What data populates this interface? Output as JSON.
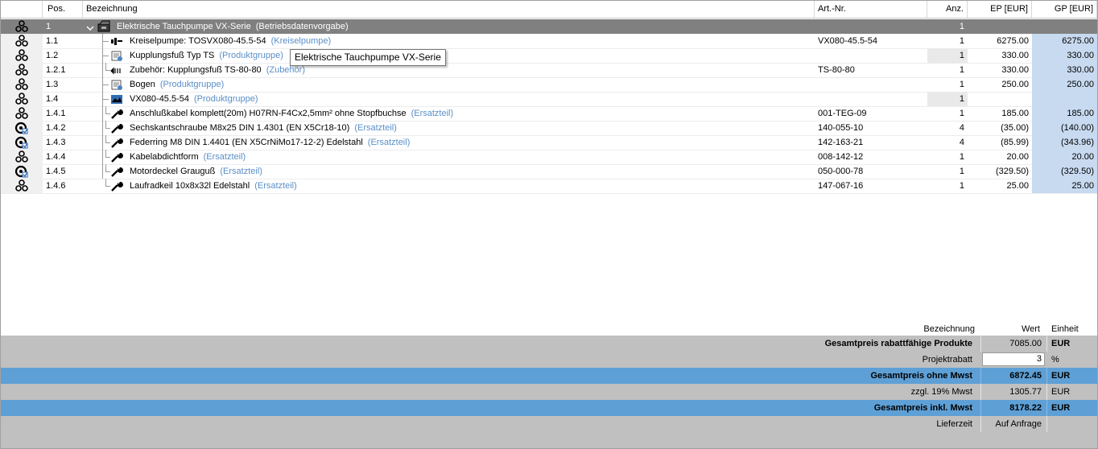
{
  "header": {
    "pos": "Pos.",
    "bezeichnung": "Bezeichnung",
    "artnr": "Art.-Nr.",
    "anz": "Anz.",
    "ep": "EP [EUR]",
    "gp": "GP [EUR]"
  },
  "rows": [
    {
      "pos": "1",
      "name": "Elektrische Tauchpumpe VX-Serie",
      "group": "(Betriebsdatenvorgabe)",
      "art": "",
      "anz": "1",
      "ep": "",
      "gp": "",
      "icon": "pump-set-icon",
      "status": "chain-icon"
    },
    {
      "pos": "1.1",
      "name": "Kreiselpumpe: TOSVX080-45.5-54",
      "group": "(Kreiselpumpe)",
      "art": "VX080-45.5-54",
      "anz": "1",
      "ep": "6275.00",
      "gp": "6275.00",
      "icon": "centrifugal-pump-icon",
      "status": "chain-icon"
    },
    {
      "pos": "1.2",
      "name": "Kupplungsfuß Typ TS",
      "group": "(Produktgruppe)",
      "art": "",
      "anz": "1",
      "ep": "330.00",
      "gp": "330.00",
      "icon": "product-group-icon",
      "status": "chain-icon"
    },
    {
      "pos": "1.2.1",
      "name": "Zubehör: Kupplungsfuß TS-80-80",
      "group": "(Zubehör)",
      "art": "TS-80-80",
      "anz": "1",
      "ep": "330.00",
      "gp": "330.00",
      "icon": "accessory-icon",
      "status": "chain-icon"
    },
    {
      "pos": "1.3",
      "name": "Bogen",
      "group": "(Produktgruppe)",
      "art": "",
      "anz": "1",
      "ep": "250.00",
      "gp": "250.00",
      "icon": "product-group-icon",
      "status": "chain-icon"
    },
    {
      "pos": "1.4",
      "name": "VX080-45.5-54",
      "group": "(Produktgruppe)",
      "art": "",
      "anz": "1",
      "ep": "",
      "gp": "",
      "icon": "pump-image-icon",
      "status": "chain-icon"
    },
    {
      "pos": "1.4.1",
      "name": "Anschlußkabel komplett(20m) H07RN-F4Cx2,5mm² ohne Stopfbuchse",
      "group": "(Ersatzteil)",
      "art": "001-TEG-09",
      "anz": "1",
      "ep": "185.00",
      "gp": "185.00",
      "icon": "wrench-icon",
      "status": "chain-icon"
    },
    {
      "pos": "1.4.2",
      "name": "Sechskantschraube M8x25 DIN 1.4301 (EN X5Cr18-10)",
      "group": "(Ersatzteil)",
      "art": "140-055-10",
      "anz": "4",
      "ep": "(35.00)",
      "gp": "(140.00)",
      "icon": "wrench-icon",
      "status": "checked-icon"
    },
    {
      "pos": "1.4.3",
      "name": "Federring M8 DIN 1.4401 (EN X5CrNiMo17-12-2) Edelstahl",
      "group": "(Ersatzteil)",
      "art": "142-163-21",
      "anz": "4",
      "ep": "(85.99)",
      "gp": "(343.96)",
      "icon": "wrench-icon",
      "status": "checked-icon"
    },
    {
      "pos": "1.4.4",
      "name": "Kabelabdichtform",
      "group": "(Ersatzteil)",
      "art": "008-142-12",
      "anz": "1",
      "ep": "20.00",
      "gp": "20.00",
      "icon": "wrench-icon",
      "status": "chain-icon"
    },
    {
      "pos": "1.4.5",
      "name": "Motordeckel Grauguß",
      "group": "(Ersatzteil)",
      "art": "050-000-78",
      "anz": "1",
      "ep": "(329.50)",
      "gp": "(329.50)",
      "icon": "wrench-icon",
      "status": "checked-icon"
    },
    {
      "pos": "1.4.6",
      "name": "Laufradkeil 10x8x32l Edelstahl",
      "group": "(Ersatzteil)",
      "art": "147-067-16",
      "anz": "1",
      "ep": "25.00",
      "gp": "25.00",
      "icon": "wrench-icon",
      "status": "chain-icon"
    }
  ],
  "tooltip": "Elektrische Tauchpumpe VX-Serie",
  "summary": {
    "hdr_bez": "Bezeichnung",
    "hdr_wert": "Wert",
    "hdr_einheit": "Einheit",
    "r1_label": "Gesamtpreis rabattfähige Produkte",
    "r1_value": "7085.00",
    "r1_unit": "EUR",
    "r2_label": "Projektrabatt",
    "r2_value": "3",
    "r2_unit": "%",
    "r3_label": "Gesamtpreis ohne Mwst",
    "r3_value": "6872.45",
    "r3_unit": "EUR",
    "r4_label": "zzgl. 19% Mwst",
    "r4_value": "1305.77",
    "r4_unit": "EUR",
    "r5_label": "Gesamtpreis inkl. Mwst",
    "r5_value": "8178.22",
    "r5_unit": "EUR",
    "r6_label": "Lieferzeit",
    "r6_value": "Auf Anfrage",
    "r6_unit": ""
  },
  "colors": {
    "selected_row": "#808080",
    "gp_column": "#c8daf0",
    "group_text": "#5a8fc8",
    "summary_gray": "#c0c0c0",
    "summary_blue": "#5ea0d6"
  }
}
